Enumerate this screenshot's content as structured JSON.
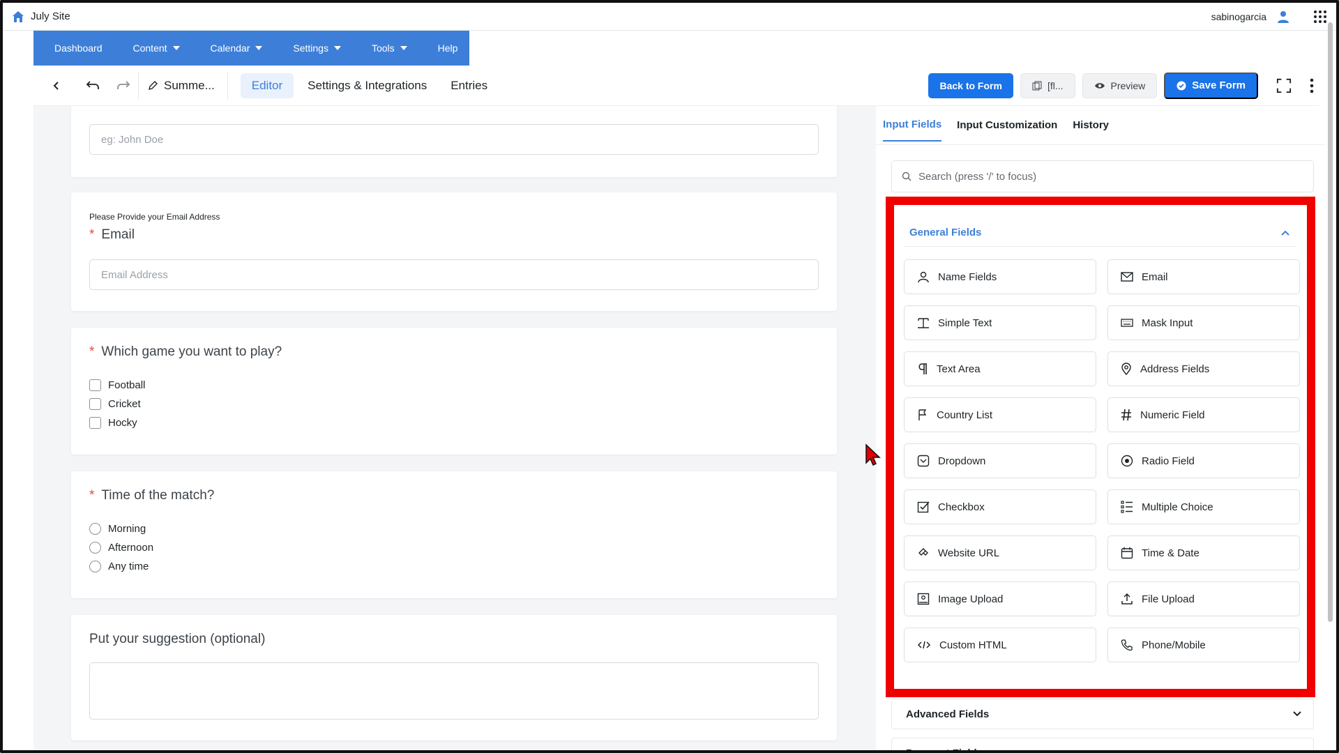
{
  "site": {
    "name": "July Site",
    "username": "sabinogarcia"
  },
  "nav": {
    "items": [
      {
        "label": "Dashboard",
        "caret": false
      },
      {
        "label": "Content",
        "caret": true
      },
      {
        "label": "Calendar",
        "caret": true
      },
      {
        "label": "Settings",
        "caret": true
      },
      {
        "label": "Tools",
        "caret": true
      },
      {
        "label": "Help",
        "caret": false
      }
    ]
  },
  "toolbar": {
    "form_title": "Summe...",
    "tab_editor": "Editor",
    "tab_settings": "Settings & Integrations",
    "tab_entries": "Entries",
    "back_to_form": "Back to Form",
    "shortcode": "[fl...",
    "preview": "Preview",
    "save_form": "Save Form"
  },
  "form": {
    "name_placeholder": "eg: John Doe",
    "email_help": "Please Provide your Email Address",
    "email_label": "Email",
    "email_placeholder": "Email Address",
    "game_label": "Which game you want to play?",
    "game_options": [
      "Football",
      "Cricket",
      "Hocky"
    ],
    "time_label": "Time of the match?",
    "time_options": [
      "Morning",
      "Afternoon",
      "Any time"
    ],
    "suggestion_label": "Put your suggestion (optional)",
    "required_mark": "*"
  },
  "panel": {
    "tabs": [
      "Input Fields",
      "Input Customization",
      "History"
    ],
    "active_tab": "Input Fields",
    "search_placeholder": "Search (press '/' to focus)",
    "general_title": "General Fields",
    "fields": [
      {
        "label": "Name Fields",
        "icon": "person-icon"
      },
      {
        "label": "Email",
        "icon": "envelope-icon"
      },
      {
        "label": "Simple Text",
        "icon": "text-icon"
      },
      {
        "label": "Mask Input",
        "icon": "keyboard-icon"
      },
      {
        "label": "Text Area",
        "icon": "paragraph-icon"
      },
      {
        "label": "Address Fields",
        "icon": "location-pin-icon"
      },
      {
        "label": "Country List",
        "icon": "flag-icon"
      },
      {
        "label": "Numeric Field",
        "icon": "hash-icon"
      },
      {
        "label": "Dropdown",
        "icon": "dropdown-icon"
      },
      {
        "label": "Radio Field",
        "icon": "radio-icon"
      },
      {
        "label": "Checkbox",
        "icon": "checkbox-icon"
      },
      {
        "label": "Multiple Choice",
        "icon": "list-icon"
      },
      {
        "label": "Website URL",
        "icon": "link-icon"
      },
      {
        "label": "Time & Date",
        "icon": "calendar-icon"
      },
      {
        "label": "Image Upload",
        "icon": "image-icon"
      },
      {
        "label": "File Upload",
        "icon": "upload-icon"
      },
      {
        "label": "Custom HTML",
        "icon": "code-icon"
      },
      {
        "label": "Phone/Mobile",
        "icon": "phone-icon"
      }
    ],
    "advanced_title": "Advanced Fields",
    "payment_title": "Payment Fields"
  },
  "colors": {
    "accent": "#3d7fd8",
    "primary_button": "#1a73e8",
    "highlight_border": "#f10000",
    "required": "#e74c3c"
  }
}
